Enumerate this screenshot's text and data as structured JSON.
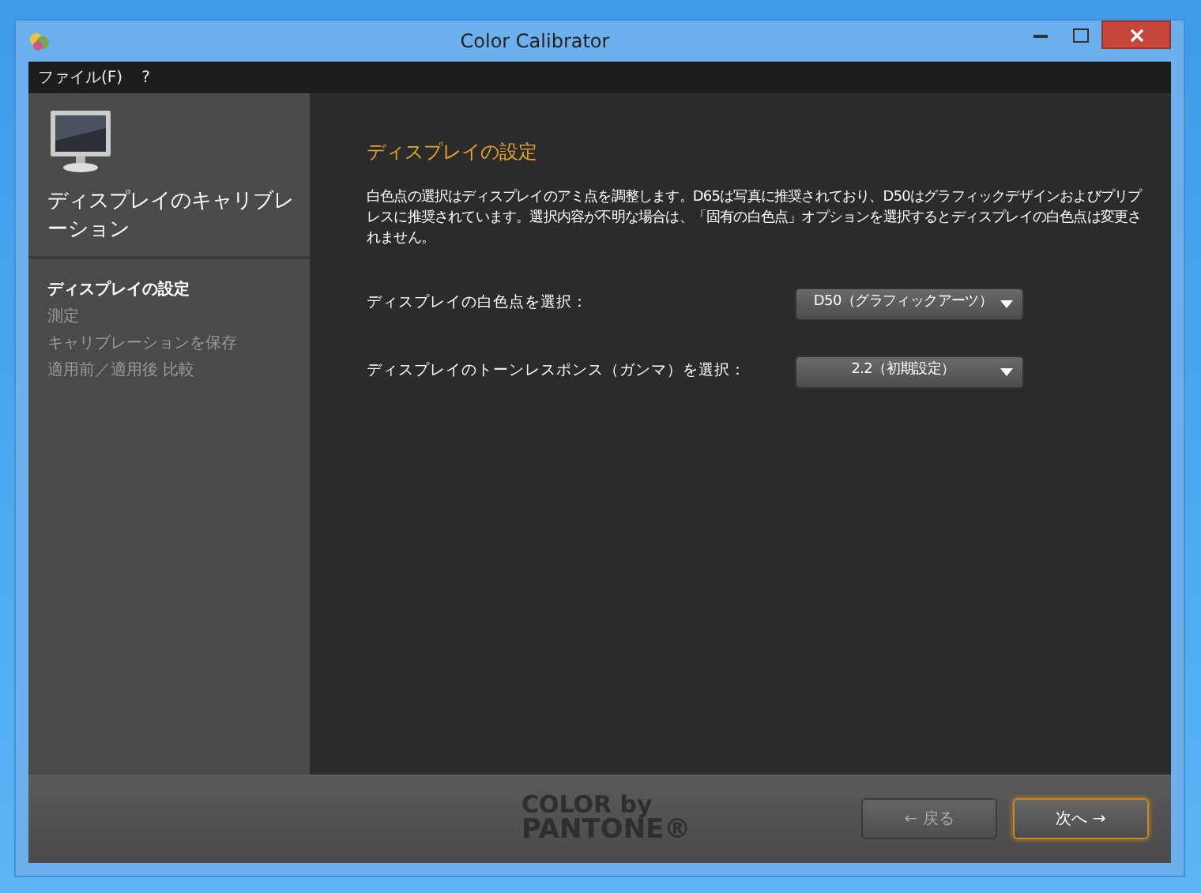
{
  "window": {
    "title": "Color Calibrator"
  },
  "menu": [
    "ファイル(F)",
    "?"
  ],
  "sidebar": {
    "heading": "ディスプレイのキャリブレーション",
    "steps": [
      {
        "label": "ディスプレイの設定",
        "selected": true,
        "disabled": false
      },
      {
        "label": "測定",
        "selected": false,
        "disabled": true
      },
      {
        "label": "キャリブレーションを保存",
        "selected": false,
        "disabled": true
      },
      {
        "label": "適用前／適用後 比較",
        "selected": false,
        "disabled": true
      }
    ]
  },
  "content": {
    "title": "ディスプレイの設定",
    "description": "白色点の選択はディスプレイのアミ点を調整します。D65は写真に推奨されており、D50はグラフィックデザインおよびプリプレスに推奨されています。選択内容が不明な場合は、「固有の白色点」オプションを選択するとディスプレイの白色点は変更されません。",
    "settings": [
      {
        "label": "ディスプレイの白色点を選択：",
        "value": "D50（グラフィックアーツ）"
      },
      {
        "label": "ディスプレイのトーンレスポンス（ガンマ）を選択：",
        "value": "2.2（初期設定）"
      }
    ]
  },
  "footer": {
    "logo": [
      "COLOR by",
      "PANTONE®"
    ],
    "buttons": [
      {
        "label": "← 戻る",
        "disabled": true,
        "focused": false
      },
      {
        "label": "次へ →",
        "disabled": false,
        "focused": true
      }
    ]
  }
}
